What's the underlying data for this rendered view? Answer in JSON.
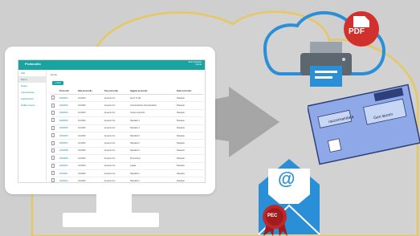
{
  "colors": {
    "teal": "#1aa3a3",
    "cloud_outline": "#e7c860",
    "blue": "#2a8fd6",
    "pdf_red": "#d0312d",
    "arrow_grey": "#a6a6a6"
  },
  "app": {
    "title": "Protocollo",
    "user_line1": "Ente Sanitario",
    "user_line2": "Utente"
  },
  "sidebar": {
    "items": [
      {
        "label": "Utili"
      },
      {
        "label": "Menu"
      },
      {
        "label": "Posta"
      },
      {
        "label": "Impostazioni"
      },
      {
        "label": "Applicazioni"
      },
      {
        "label": "Hidden Items"
      }
    ]
  },
  "main": {
    "breadcrumb": "Home",
    "new_button": "+ New",
    "columns": [
      "",
      "Protocollo",
      "Data protocollo",
      "Tipo protocollo",
      "Oggetto protocollo",
      "Stato protocollo"
    ],
    "rows": [
      [
        "20200001",
        "1/1/2020",
        "Generico Inv.",
        "ALLO IT 101",
        "Passante"
      ],
      [
        "20200002",
        "1/1/2020",
        "Generico Inv.",
        "Comunicazione Amministrativa",
        "Passante"
      ],
      [
        "20200003",
        "1/1/2020",
        "Generico Inv.",
        "Avviso Consorzio",
        "Passante"
      ],
      [
        "20200004",
        "1/1/2020",
        "Generico Inv.",
        "Standard 1",
        "Passante"
      ],
      [
        "20200005",
        "1/1/2020",
        "Generico Inv.",
        "Standard 1",
        "Passante"
      ],
      [
        "20200006",
        "1/1/2020",
        "Generico Inv.",
        "Standard 2",
        "Passante"
      ],
      [
        "20200007",
        "1/1/2020",
        "Generico Inv.",
        "Standard 2",
        "Passante"
      ],
      [
        "20200008",
        "1/1/2020",
        "Generico Inv.",
        "Standard 2",
        "Passante"
      ],
      [
        "20200009",
        "1/1/2020",
        "Generico Inv.",
        "Promozione",
        "Passante"
      ],
      [
        "20200010",
        "1/1/2020",
        "Generico Inv.",
        "Legale",
        "Passante"
      ],
      [
        "20200011",
        "1/1/2020",
        "Generico Inv.",
        "Standard 1",
        "Passante"
      ],
      [
        "20200012",
        "1/1/2020",
        "Generico Inv.",
        "Standard 1",
        "Passante"
      ],
      [
        "20200013",
        "1/1/2020",
        "Generico Inv.",
        "Technical 1",
        "Passante"
      ]
    ]
  },
  "icons": {
    "pdf_badge": "PDF",
    "printer": "printer-icon",
    "mail": "mail-icon",
    "pec_seal": "PEC",
    "letter_label_left": "raccomandata",
    "letter_label_right": "Gen lavoro"
  }
}
